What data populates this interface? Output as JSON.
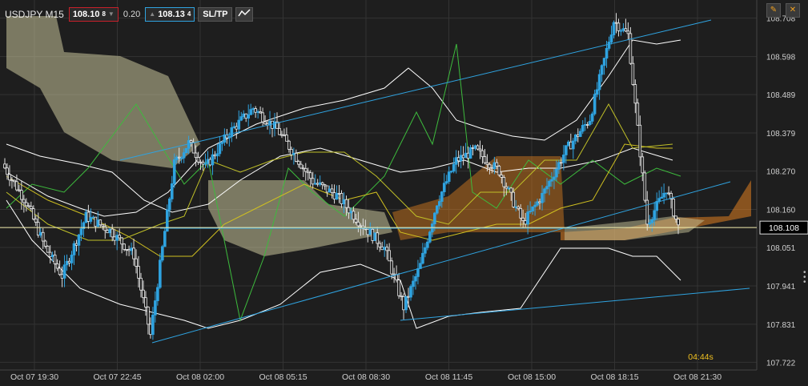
{
  "toolbar": {
    "symbol": "USDJPY M15",
    "bid": "108.10",
    "bid_small": "8",
    "spread": "0.20",
    "ask": "108.13",
    "ask_small": "4",
    "sltp_label": "SL/TP",
    "chart_type_icon": "line-chart-icon"
  },
  "window_controls": [
    {
      "name": "edit-icon",
      "glyph": "✎"
    },
    {
      "name": "close-icon",
      "glyph": "✕"
    }
  ],
  "colors": {
    "background": "#1e1e1e",
    "grid": "#333333",
    "candle_up": "#2fa3e0",
    "candle_down": "#ffffff",
    "price_line": "#f5f0b0",
    "bollinger": "#ffffff",
    "trendline": "#2fa3e0",
    "rsi_green": "#3dbb3d",
    "cloud_bull": "#fffaa0",
    "cloud_bear": "#e08020",
    "tenkan": "#d0c020",
    "countdown": "#f0c020"
  },
  "chart_data": {
    "type": "candlestick",
    "symbol": "USDJPY",
    "timeframe": "M15",
    "ylim": [
      107.7,
      108.76
    ],
    "y_ticks": [
      "108.708",
      "108.598",
      "108.489",
      "108.379",
      "108.270",
      "108.160",
      "108.051",
      "107.941",
      "107.831",
      "107.722"
    ],
    "x_ticks": [
      "Oct 07 19:30",
      "Oct 07 22:45",
      "Oct 08 02:00",
      "Oct 08 05:15",
      "Oct 08 08:30",
      "Oct 08 11:45",
      "Oct 08 15:00",
      "Oct 08 18:15",
      "Oct 08 21:30"
    ],
    "current_price": 108.108,
    "current_price_label": "108.108",
    "countdown": "04:44s",
    "grid": true
  }
}
